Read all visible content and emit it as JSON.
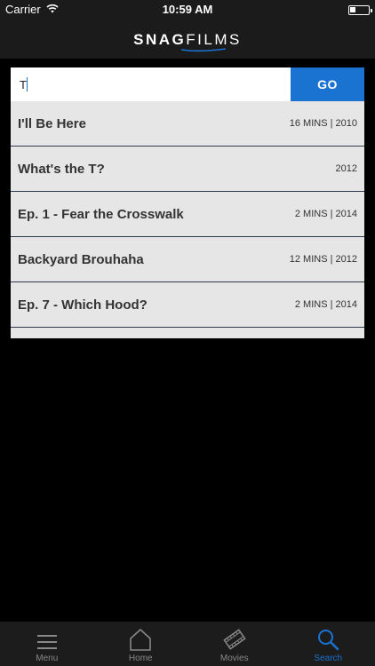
{
  "status_bar": {
    "carrier": "Carrier",
    "time": "10:59 AM"
  },
  "header": {
    "logo_part1": "SNAG",
    "logo_part2": "FILMS"
  },
  "search": {
    "value": "T",
    "go_label": "GO"
  },
  "results": [
    {
      "title": "I'll Be Here",
      "meta": "16 MINS | 2010"
    },
    {
      "title": "What's the T?",
      "meta": "2012"
    },
    {
      "title": "Ep. 1 - Fear the Crosswalk",
      "meta": "2 MINS | 2014"
    },
    {
      "title": "Backyard Brouhaha",
      "meta": "12 MINS | 2012"
    },
    {
      "title": "Ep. 7 - Which Hood?",
      "meta": "2 MINS | 2014"
    }
  ],
  "tabs": [
    {
      "label": "Menu",
      "icon": "menu-icon"
    },
    {
      "label": "Home",
      "icon": "home-icon"
    },
    {
      "label": "Movies",
      "icon": "film-icon"
    },
    {
      "label": "Search",
      "icon": "search-icon"
    }
  ],
  "active_tab": "Search",
  "colors": {
    "accent": "#1a73d1",
    "panel_bg": "#e6e6e6",
    "header_bg": "#1b1b1b"
  }
}
